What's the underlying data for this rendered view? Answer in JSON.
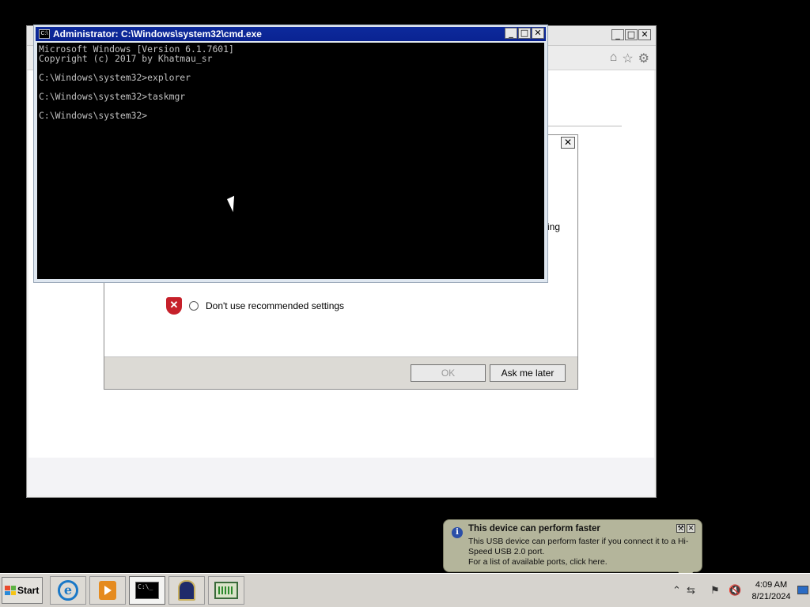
{
  "ie_window": {
    "buttons": {
      "minimize": "_",
      "maximize": "□",
      "close": "✕"
    },
    "tools": {
      "home": "⌂",
      "favorites": "☆",
      "settings": "⚙"
    }
  },
  "settings_dialog": {
    "close": "✕",
    "partial_text": "ing",
    "dont_use_label": "Don't use recommended settings",
    "ok_label": "OK",
    "ask_later_label": "Ask me later"
  },
  "cmd_window": {
    "title": "Administrator: C:\\Windows\\system32\\cmd.exe",
    "icon_text": "C:\\",
    "buttons": {
      "minimize": "_",
      "maximize": "□",
      "close": "✕"
    },
    "console_text": "Microsoft Windows [Version 6.1.7601]\nCopyright (c) 2017 by Khatmau_sr\n\nC:\\Windows\\system32>explorer\n\nC:\\Windows\\system32>taskmgr\n\nC:\\Windows\\system32>"
  },
  "notification": {
    "title": "This device can perform faster",
    "line1": "This USB device can perform faster if you connect it to a Hi-Speed USB 2.0 port.",
    "line2": "For a list of available ports, click here.",
    "options": "⚒",
    "close": "✕"
  },
  "taskbar": {
    "start_label": "Start",
    "cmd_icon_text": "C:\\_",
    "tray": {
      "show_hidden": "⌃",
      "usb": "⇆",
      "action_center": "⚑",
      "volume": "🔇"
    },
    "clock": {
      "time": "4:09 AM",
      "date": "8/21/2024"
    }
  }
}
